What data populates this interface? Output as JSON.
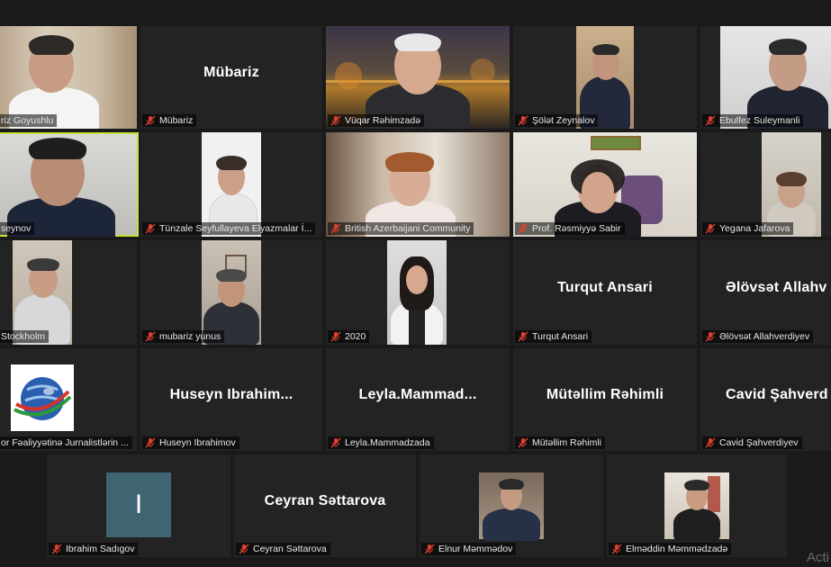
{
  "participants": [
    {
      "label": "riz Goyushlu",
      "mode": "video"
    },
    {
      "label": "Mübariz",
      "display": "Mübariz",
      "mode": "name"
    },
    {
      "label": "Vüqar Rəhimzadə",
      "mode": "video"
    },
    {
      "label": "Şölət Zeynalov",
      "mode": "video"
    },
    {
      "label": "Ebulfez Suleymanli",
      "mode": "video"
    },
    {
      "label": "seynov",
      "mode": "video",
      "active_speaker": true
    },
    {
      "label": "Tünzale Seyfullayeva Elyazmalar İ...",
      "mode": "video"
    },
    {
      "label": "British Azerbaijani Community",
      "mode": "video"
    },
    {
      "label": "Prof. Rəsmiyyə Sabir",
      "mode": "video"
    },
    {
      "label": "Yegana Jafarova",
      "mode": "video"
    },
    {
      "label": "Stockholm",
      "mode": "video"
    },
    {
      "label": "mubariz yunus",
      "mode": "video"
    },
    {
      "label": "2020",
      "mode": "video"
    },
    {
      "label": "Turqut Ansari",
      "display": "Turqut Ansari",
      "mode": "name"
    },
    {
      "label": "Əlövsət Allahverdiyev",
      "display": "Əlövsət  Allahv",
      "mode": "name"
    },
    {
      "label": "or Fəaliyyətinə Jurnalistlərin ...",
      "mode": "logo"
    },
    {
      "label": "Huseyn Ibrahimov",
      "display": "Huseyn  Ibrahim...",
      "mode": "name"
    },
    {
      "label": "Leyla.Mammadzada",
      "display": "Leyla.Mammad...",
      "mode": "name"
    },
    {
      "label": "Mütəllim Rəhimli",
      "display": "Mütəllim Rəhimli",
      "mode": "name"
    },
    {
      "label": "Cavid Şahverdiyev",
      "display": "Cavid  Şahverd",
      "mode": "name"
    },
    {
      "label": "Ibrahim Sadıgov",
      "initial": "I",
      "mode": "initial"
    },
    {
      "label": "Ceyran Səttarova",
      "display": "Ceyran Səttarova",
      "mode": "name"
    },
    {
      "label": "Elnur Məmmədov",
      "mode": "video"
    },
    {
      "label": "Elməddin Məmmədzadə",
      "mode": "video"
    }
  ],
  "watermark": "Acti",
  "colors": {
    "background": "#1a1a1a",
    "tile": "#232323",
    "active_border": "#c6e23a",
    "mic_muted": "#e0412f",
    "initial_box": "#3f6472"
  },
  "icons": {
    "muted_mic": "mic-muted-icon",
    "logo": "globe-logo"
  }
}
